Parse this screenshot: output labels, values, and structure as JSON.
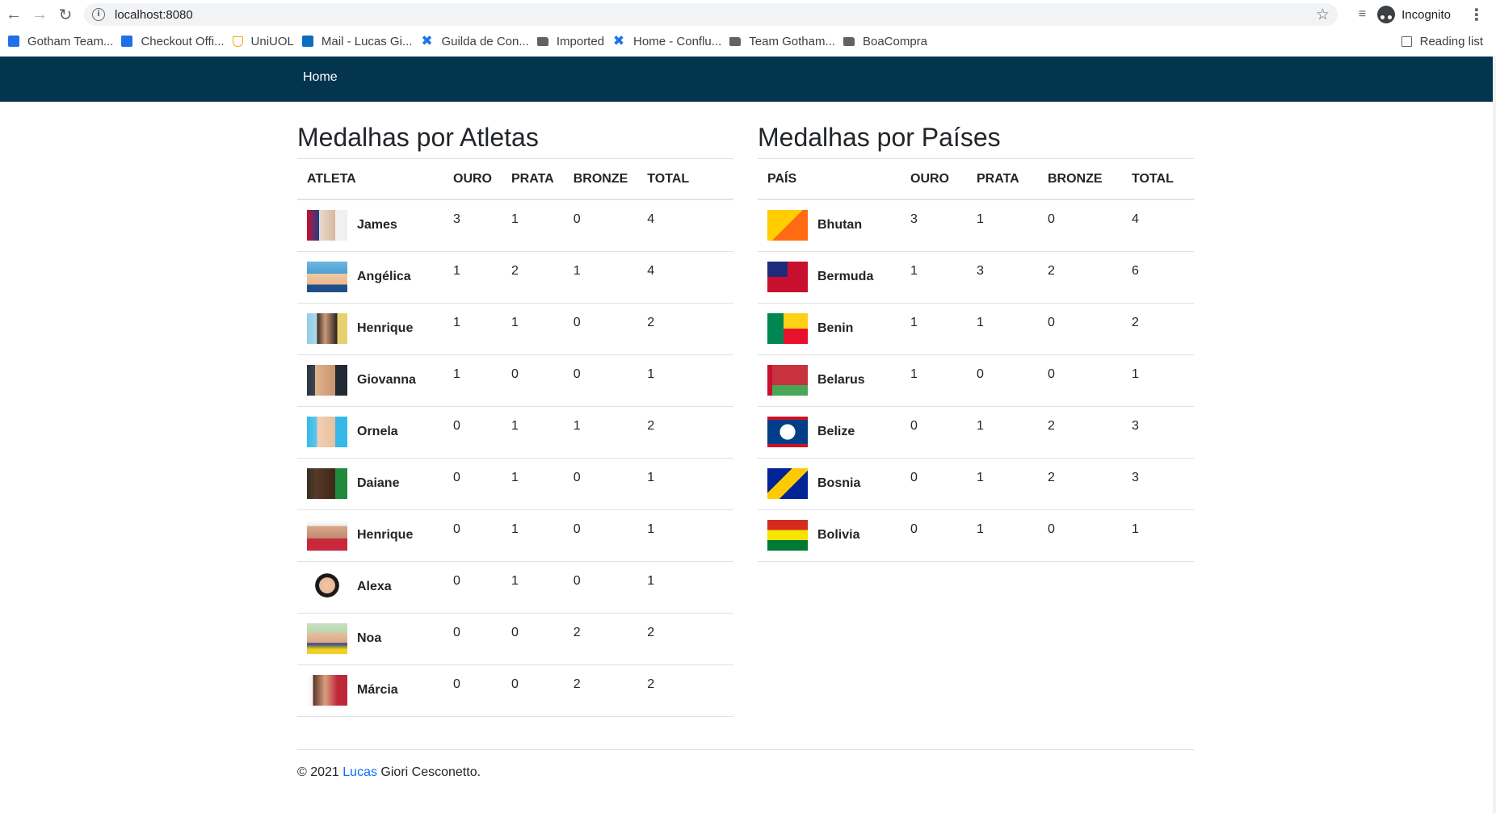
{
  "browser": {
    "url": "localhost:8080",
    "profile_label": "Incognito",
    "bookmarks": [
      {
        "label": "Gotham Team...",
        "icon": "team-icon"
      },
      {
        "label": "Checkout Offi...",
        "icon": "team-icon"
      },
      {
        "label": "UniUOL",
        "icon": "uol-icon"
      },
      {
        "label": "Mail - Lucas Gi...",
        "icon": "outlook-icon"
      },
      {
        "label": "Guilda de Con...",
        "icon": "confluence-icon"
      },
      {
        "label": "Imported",
        "icon": "folder-icon"
      },
      {
        "label": "Home - Conflu...",
        "icon": "confluence-icon"
      },
      {
        "label": "Team Gotham...",
        "icon": "folder-icon"
      },
      {
        "label": "BoaCompra",
        "icon": "folder-icon"
      }
    ],
    "reading_list": "Reading list"
  },
  "navbar": {
    "home": "Home"
  },
  "athletes": {
    "title": "Medalhas por Atletas",
    "headers": [
      "ATLETA",
      "OURO",
      "PRATA",
      "BRONZE",
      "TOTAL"
    ],
    "rows": [
      {
        "name": "James",
        "ouro": "3",
        "prata": "1",
        "bronze": "0",
        "total": "4"
      },
      {
        "name": "Angélica",
        "ouro": "1",
        "prata": "2",
        "bronze": "1",
        "total": "4"
      },
      {
        "name": "Henrique",
        "ouro": "1",
        "prata": "1",
        "bronze": "0",
        "total": "2"
      },
      {
        "name": "Giovanna",
        "ouro": "1",
        "prata": "0",
        "bronze": "0",
        "total": "1"
      },
      {
        "name": "Ornela",
        "ouro": "0",
        "prata": "1",
        "bronze": "1",
        "total": "2"
      },
      {
        "name": "Daiane",
        "ouro": "0",
        "prata": "1",
        "bronze": "0",
        "total": "1"
      },
      {
        "name": "Henrique",
        "ouro": "0",
        "prata": "1",
        "bronze": "0",
        "total": "1"
      },
      {
        "name": "Alexa",
        "ouro": "0",
        "prata": "1",
        "bronze": "0",
        "total": "1"
      },
      {
        "name": "Noa",
        "ouro": "0",
        "prata": "0",
        "bronze": "2",
        "total": "2"
      },
      {
        "name": "Márcia",
        "ouro": "0",
        "prata": "0",
        "bronze": "2",
        "total": "2"
      }
    ]
  },
  "countries": {
    "title": "Medalhas por Países",
    "headers": [
      "PAÍS",
      "OURO",
      "PRATA",
      "BRONZE",
      "TOTAL"
    ],
    "rows": [
      {
        "name": "Bhutan",
        "ouro": "3",
        "prata": "1",
        "bronze": "0",
        "total": "4"
      },
      {
        "name": "Bermuda",
        "ouro": "1",
        "prata": "3",
        "bronze": "2",
        "total": "6"
      },
      {
        "name": "Benin",
        "ouro": "1",
        "prata": "1",
        "bronze": "0",
        "total": "2"
      },
      {
        "name": "Belarus",
        "ouro": "1",
        "prata": "0",
        "bronze": "0",
        "total": "1"
      },
      {
        "name": "Belize",
        "ouro": "0",
        "prata": "1",
        "bronze": "2",
        "total": "3"
      },
      {
        "name": "Bosnia",
        "ouro": "0",
        "prata": "1",
        "bronze": "2",
        "total": "3"
      },
      {
        "name": "Bolivia",
        "ouro": "0",
        "prata": "1",
        "bronze": "0",
        "total": "1"
      }
    ]
  },
  "footer": {
    "prefix": "© 2021 ",
    "link": "Lucas",
    "suffix": " Giori Cesconetto."
  },
  "colors": {
    "navbar": "#04354e",
    "link": "#0d6efd"
  }
}
